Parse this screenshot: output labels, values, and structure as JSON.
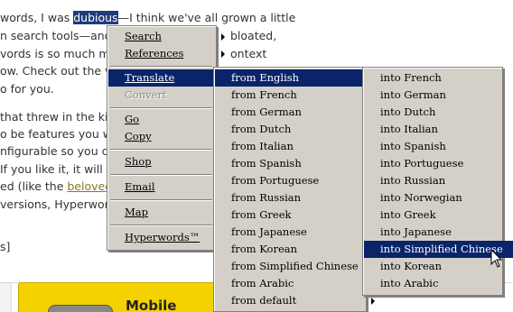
{
  "article": {
    "l1_a": "words, I was ",
    "l1_sel": "dubious",
    "l1_b": "—I think we've all grown a little",
    "l2_a": "n search tools—and th",
    "l2_b": "bloated,",
    "l3_a": "vords is so much more",
    "l3_b": "ontext",
    "l4": "ow. Check out the vid",
    "l5": "o for you.",
    "l6": "that threw in the kitc",
    "l7": "o be features you wan",
    "l8": "nfigurable so you can t",
    "l9": "If you like it, it will pro",
    "l10_a": "ed (like the ",
    "l10_link": "beloved A",
    "l11": "versions, Hyperwords'",
    "l12": "s]",
    "ad_text": "Mobile"
  },
  "main_menu": [
    {
      "label": "Search"
    },
    {
      "label": "References"
    },
    {
      "label": "Translate"
    },
    {
      "label": "Convert"
    },
    {
      "label": "Go"
    },
    {
      "label": "Copy"
    },
    {
      "label": "Shop"
    },
    {
      "label": "Email"
    },
    {
      "label": "Map"
    },
    {
      "label": "Hyperwords™"
    }
  ],
  "translate_menu": [
    {
      "label": "from English"
    },
    {
      "label": "from French"
    },
    {
      "label": "from German"
    },
    {
      "label": "from Dutch"
    },
    {
      "label": "from Italian"
    },
    {
      "label": "from Spanish"
    },
    {
      "label": "from Portuguese"
    },
    {
      "label": "from Russian"
    },
    {
      "label": "from Greek"
    },
    {
      "label": "from Japanese"
    },
    {
      "label": "from Korean"
    },
    {
      "label": "from Simplified Chinese"
    },
    {
      "label": "from Arabic"
    },
    {
      "label": "from default"
    }
  ],
  "english_menu": [
    {
      "label": "into French"
    },
    {
      "label": "into German"
    },
    {
      "label": "into Dutch"
    },
    {
      "label": "into Italian"
    },
    {
      "label": "into Spanish"
    },
    {
      "label": "into Portuguese"
    },
    {
      "label": "into Russian"
    },
    {
      "label": "into Norwegian"
    },
    {
      "label": "into Greek"
    },
    {
      "label": "into Japanese"
    },
    {
      "label": "into Simplified Chinese"
    },
    {
      "label": "into Korean"
    },
    {
      "label": "into Arabic"
    }
  ],
  "icons": {
    "submenu": "chevron-right-icon",
    "cursor": "mouse-pointer-icon"
  },
  "colors": {
    "menu_bg": "#d4d0c8",
    "highlight": "#0a246a",
    "selection": "#1f3b7a",
    "ad_bg": "#f4d100"
  }
}
